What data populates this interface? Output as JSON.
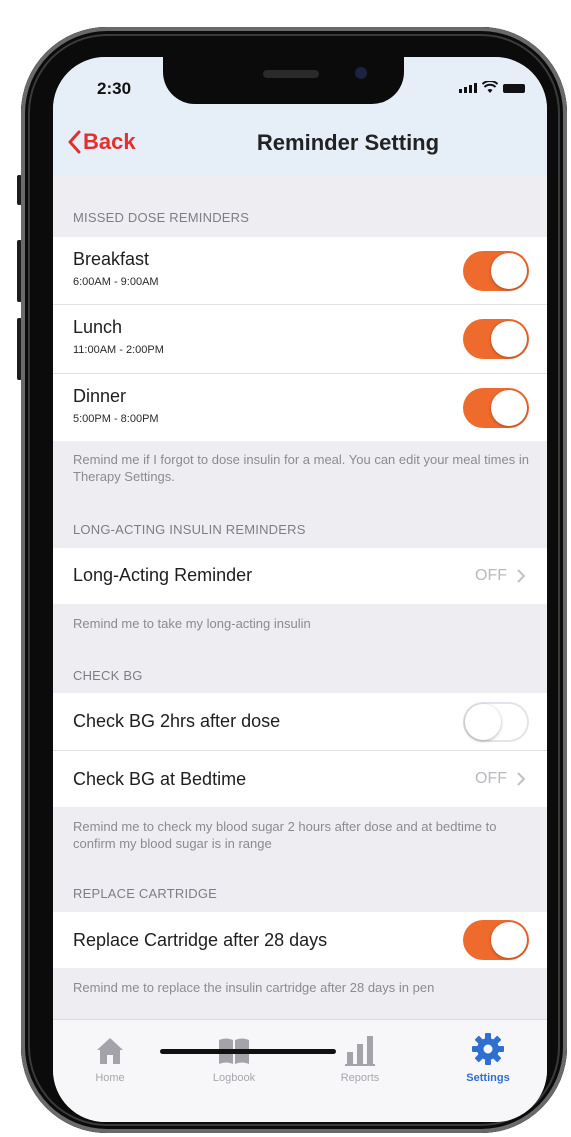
{
  "status": {
    "time": "2:30"
  },
  "nav": {
    "back_label": "Back",
    "title": "Reminder Setting"
  },
  "missed": {
    "header": "MISSED DOSE REMINDERS",
    "items": [
      {
        "label": "Breakfast",
        "sub": "6:00AM - 9:00AM",
        "on": true
      },
      {
        "label": "Lunch",
        "sub": "11:00AM - 2:00PM",
        "on": true
      },
      {
        "label": "Dinner",
        "sub": "5:00PM - 8:00PM",
        "on": true
      }
    ],
    "note": "Remind me if I forgot to dose insulin for a meal. You can edit your meal times in Therapy Settings."
  },
  "long_acting": {
    "header": "LONG-ACTING INSULIN REMINDERS",
    "row_label": "Long-Acting Reminder",
    "row_value": "OFF",
    "note": "Remind me to take my long-acting insulin"
  },
  "check_bg": {
    "header": "CHECK BG",
    "after_dose_label": "Check BG 2hrs after dose",
    "after_dose_on": false,
    "bedtime_label": "Check BG at Bedtime",
    "bedtime_value": "OFF",
    "note": "Remind me to check my blood sugar 2 hours after dose and at bedtime to confirm my blood sugar is in range"
  },
  "cartridge": {
    "header": "REPLACE CARTRIDGE",
    "row_label": "Replace Cartridge after 28 days",
    "on": true,
    "note": "Remind me to replace the insulin cartridge after 28 days in pen"
  },
  "tabs": [
    {
      "label": "Home",
      "icon": "home-icon",
      "active": false
    },
    {
      "label": "Logbook",
      "icon": "book-icon",
      "active": false
    },
    {
      "label": "Reports",
      "icon": "bar-chart-icon",
      "active": false
    },
    {
      "label": "Settings",
      "icon": "gear-icon",
      "active": true
    }
  ],
  "colors": {
    "accent_toggle": "#ef6a2d",
    "back_red": "#e0312f",
    "active_tab": "#2e6fd0"
  }
}
